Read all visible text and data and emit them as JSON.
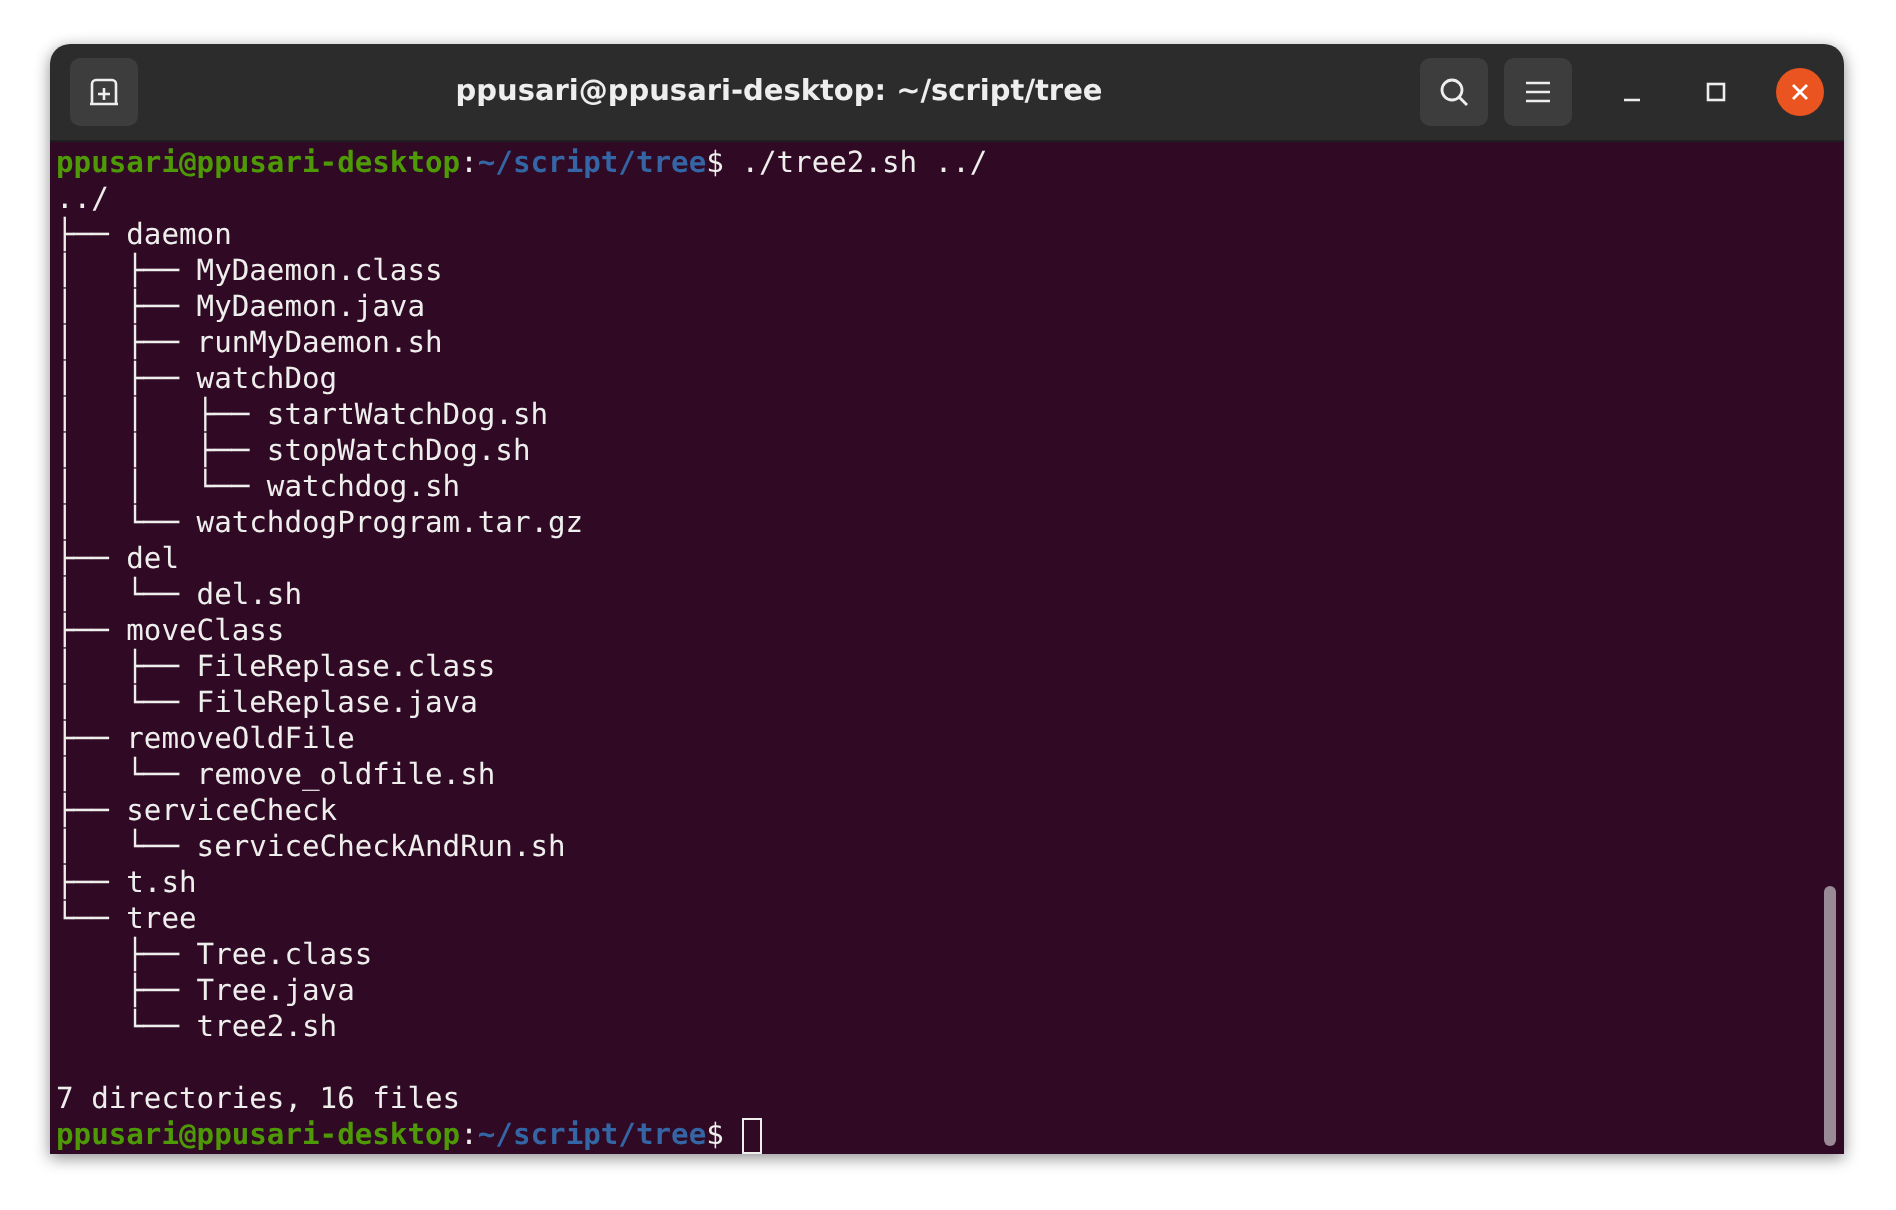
{
  "window": {
    "title": "ppusari@ppusari-desktop: ~/script/tree"
  },
  "terminal": {
    "lines": [
      {
        "kind": "prompt",
        "user": "ppusari@ppusari-desktop",
        "separator": ":",
        "path": "~/script/tree",
        "command": "$ ./tree2.sh ../",
        "cursor": false
      },
      {
        "kind": "output",
        "text": "../"
      },
      {
        "kind": "output",
        "text": "├── daemon"
      },
      {
        "kind": "output",
        "text": "│   ├── MyDaemon.class"
      },
      {
        "kind": "output",
        "text": "│   ├── MyDaemon.java"
      },
      {
        "kind": "output",
        "text": "│   ├── runMyDaemon.sh"
      },
      {
        "kind": "output",
        "text": "│   ├── watchDog"
      },
      {
        "kind": "output",
        "text": "│   │   ├── startWatchDog.sh"
      },
      {
        "kind": "output",
        "text": "│   │   ├── stopWatchDog.sh"
      },
      {
        "kind": "output",
        "text": "│   │   └── watchdog.sh"
      },
      {
        "kind": "output",
        "text": "│   └── watchdogProgram.tar.gz"
      },
      {
        "kind": "output",
        "text": "├── del"
      },
      {
        "kind": "output",
        "text": "│   └── del.sh"
      },
      {
        "kind": "output",
        "text": "├── moveClass"
      },
      {
        "kind": "output",
        "text": "│   ├── FileReplase.class"
      },
      {
        "kind": "output",
        "text": "│   └── FileReplase.java"
      },
      {
        "kind": "output",
        "text": "├── removeOldFile"
      },
      {
        "kind": "output",
        "text": "│   └── remove_oldfile.sh"
      },
      {
        "kind": "output",
        "text": "├── serviceCheck"
      },
      {
        "kind": "output",
        "text": "│   └── serviceCheckAndRun.sh"
      },
      {
        "kind": "output",
        "text": "├── t.sh"
      },
      {
        "kind": "output",
        "text": "└── tree"
      },
      {
        "kind": "output",
        "text": "    ├── Tree.class"
      },
      {
        "kind": "output",
        "text": "    ├── Tree.java"
      },
      {
        "kind": "output",
        "text": "    └── tree2.sh"
      },
      {
        "kind": "blank"
      },
      {
        "kind": "output",
        "text": "7 directories, 16 files"
      },
      {
        "kind": "prompt",
        "user": "ppusari@ppusari-desktop",
        "separator": ":",
        "path": "~/script/tree",
        "command": "$",
        "cursor": true
      }
    ]
  }
}
